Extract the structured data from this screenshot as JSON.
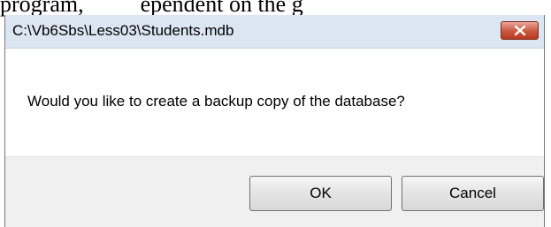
{
  "background_text": [
    "program,",
    "ependent on the g"
  ],
  "dialog": {
    "title": "C:\\Vb6Sbs\\Less03\\Students.mdb",
    "message": "Would you like to create a backup copy of the database?",
    "buttons": {
      "ok_label": "OK",
      "cancel_label": "Cancel"
    },
    "close_icon": "close-icon",
    "colors": {
      "titlebar": "#dce6f2",
      "close_button": "#c9573f",
      "footer": "#f0f0f0"
    }
  }
}
